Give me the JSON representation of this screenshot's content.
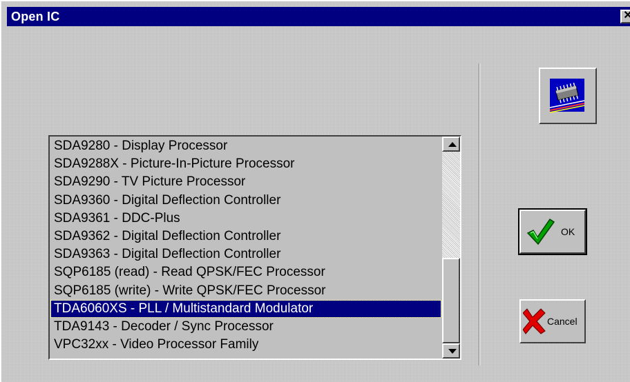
{
  "window": {
    "title": "Open IC",
    "close_glyph": "✕"
  },
  "chip_button": {
    "icon": "ic-chip-icon"
  },
  "list": {
    "items": [
      "SDA9280 - Display Processor",
      "SDA9288X - Picture-In-Picture Processor",
      "SDA9290 - TV Picture Processor",
      "SDA9360 - Digital Deflection Controller",
      "SDA9361 - DDC-Plus",
      "SDA9362 - Digital Deflection Controller",
      "SDA9363 - Digital Deflection Controller",
      "SQP6185 (read) - Read QPSK/FEC Processor",
      "SQP6185 (write) - Write QPSK/FEC Processor",
      "TDA6060XS - PLL / Multistandard Modulator",
      "TDA9143 - Decoder / Sync Processor",
      "VPC32xx - Video Processor Family"
    ],
    "selected_index": 9
  },
  "buttons": {
    "ok_label": "OK",
    "ok_icon": "checkmark-icon",
    "cancel_label": "Cancel",
    "cancel_icon": "red-x-icon"
  },
  "colors": {
    "titlebar": "#000080",
    "selection": "#000080",
    "face": "#c0c0c0"
  }
}
